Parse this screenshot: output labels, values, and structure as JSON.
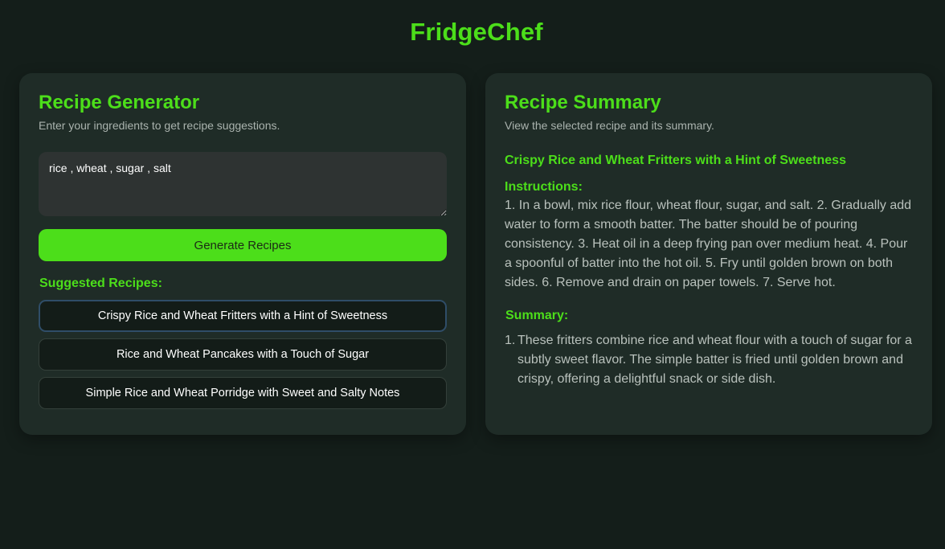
{
  "app": {
    "title": "FridgeChef"
  },
  "generator": {
    "heading": "Recipe Generator",
    "subtitle": "Enter your ingredients to get recipe suggestions.",
    "ingredients_value": "rice , wheat , sugar , salt",
    "generate_label": "Generate Recipes",
    "suggested_heading": "Suggested Recipes:",
    "recipes": [
      {
        "label": "Crispy Rice and Wheat Fritters with a Hint of Sweetness",
        "selected": true
      },
      {
        "label": "Rice and Wheat Pancakes with a Touch of Sugar",
        "selected": false
      },
      {
        "label": "Simple Rice and Wheat Porridge with Sweet and Salty Notes",
        "selected": false
      }
    ]
  },
  "summary": {
    "heading": "Recipe Summary",
    "subtitle": "View the selected recipe and its summary.",
    "recipe_title": "Crispy Rice and Wheat Fritters with a Hint of Sweetness",
    "instructions_label": "Instructions:",
    "instructions_text": "1. In a bowl, mix rice flour, wheat flour, sugar, and salt. 2. Gradually add water to form a smooth batter. The batter should be of pouring consistency. 3. Heat oil in a deep frying pan over medium heat. 4. Pour a spoonful of batter into the hot oil. 5. Fry until golden brown on both sides. 6. Remove and drain on paper towels. 7. Serve hot.",
    "summary_label": "Summary:",
    "summary_items": [
      {
        "num": "1.",
        "text": "These fritters combine rice and wheat flour with a touch of sugar for a subtly sweet flavor. The simple batter is fried until golden brown and crispy, offering a delightful snack or side dish."
      }
    ]
  },
  "colors": {
    "background": "#141e1a",
    "panel": "#1f2c27",
    "accent": "#4cde1a",
    "selected_border": "#2f4d68"
  }
}
